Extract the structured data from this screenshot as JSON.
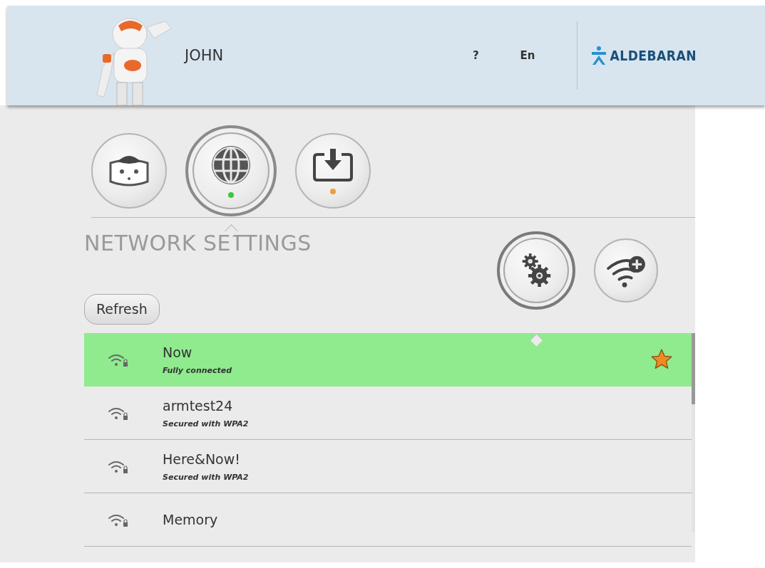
{
  "header": {
    "user_name": "JOHN",
    "help": "?",
    "language": "En",
    "logo_text": "ALDEBARAN"
  },
  "tabs": [
    {
      "kind": "robot",
      "selected": false
    },
    {
      "kind": "network",
      "selected": true,
      "color": "#3ec63e"
    },
    {
      "kind": "update",
      "selected": false,
      "color": "#e8a040"
    }
  ],
  "section": {
    "title": "NETWORK SETTINGS",
    "refresh": "Refresh",
    "subtabs": [
      {
        "kind": "settings",
        "selected": true
      },
      {
        "kind": "add_network",
        "selected": false
      }
    ]
  },
  "networks": [
    {
      "name": "Now",
      "status": "Fully connected",
      "selected": true,
      "favorite": true
    },
    {
      "name": "armtest24",
      "status": "Secured with WPA2",
      "selected": false,
      "favorite": false
    },
    {
      "name": "Here&Now!",
      "status": "Secured with WPA2",
      "selected": false,
      "favorite": false
    },
    {
      "name": "Memory",
      "selected": false,
      "favorite": false
    }
  ]
}
